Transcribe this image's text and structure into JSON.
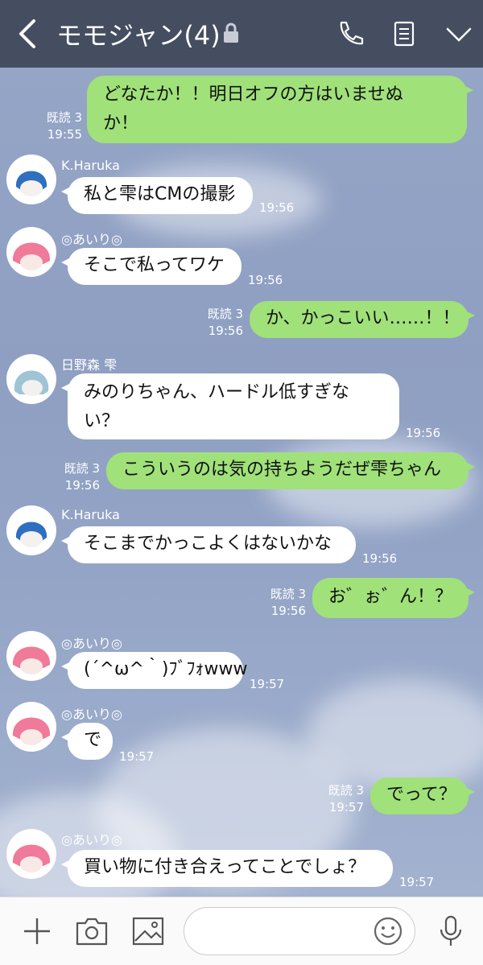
{
  "header": {
    "title": "モモジャン(4)",
    "icons": [
      "back-chevron-icon",
      "lock-icon",
      "phone-icon",
      "notes-icon",
      "chevron-down-icon"
    ]
  },
  "colors": {
    "header_bg": "#454d61",
    "outgoing_bubble": "#a0e17a",
    "incoming_bubble": "#ffffff"
  },
  "messages": [
    {
      "dir": "out",
      "lines": [
        "どなたか！！明日オフの方はいませぬ",
        "か！"
      ],
      "read": "既読 3",
      "time": "19:55"
    },
    {
      "dir": "in",
      "sender": "K.Haruka",
      "lines": [
        "私と雫はCMの撮影"
      ],
      "time": "19:56"
    },
    {
      "dir": "in",
      "sender": "◎あいり◎",
      "lines": [
        "そこで私ってワケ"
      ],
      "time": "19:56"
    },
    {
      "dir": "out",
      "lines": [
        "か、かっこいい……！！"
      ],
      "read": "既読 3",
      "time": "19:56"
    },
    {
      "dir": "in",
      "sender": "日野森 雫",
      "lines": [
        "みのりちゃん、ハードル低すぎな",
        "い？"
      ],
      "time": "19:56"
    },
    {
      "dir": "out",
      "lines": [
        "こういうのは気の持ちようだぜ雫ちゃん"
      ],
      "read": "既読 3",
      "time": "19:56"
    },
    {
      "dir": "in",
      "sender": "K.Haruka",
      "lines": [
        "そこまでかっこよくはないかな"
      ],
      "time": "19:56"
    },
    {
      "dir": "out",
      "lines": [
        "お゛ぉ゛ん！？"
      ],
      "read": "既読 3",
      "time": "19:56"
    },
    {
      "dir": "in",
      "sender": "◎あいり◎",
      "lines": [
        "(´^ω^｀)ﾌﾞﾌｫwww"
      ],
      "time": "19:57"
    },
    {
      "dir": "in",
      "sender": "◎あいり◎",
      "lines": [
        "で"
      ],
      "time": "19:57"
    },
    {
      "dir": "out",
      "lines": [
        "でって？"
      ],
      "read": "既読 3",
      "time": "19:57"
    },
    {
      "dir": "in",
      "sender": "◎あいり◎",
      "lines": [
        "買い物に付き合えってことでしょ？"
      ],
      "time": "19:57"
    }
  ],
  "input_bar": {
    "placeholder": "",
    "icons": [
      "plus-icon",
      "camera-icon",
      "image-icon",
      "emoji-icon",
      "microphone-icon"
    ]
  }
}
